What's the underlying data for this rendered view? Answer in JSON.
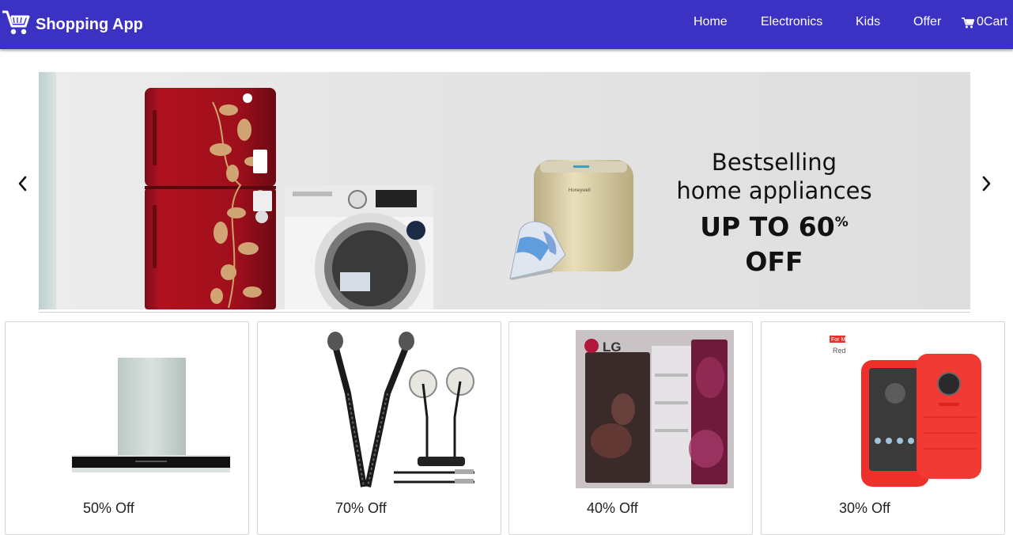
{
  "navbar": {
    "brand": "Shopping App",
    "brand_icon": "shopping-cart-icon",
    "links": [
      "Home",
      "Electronics",
      "Kids",
      "Offer"
    ],
    "cart_count": "0",
    "cart_label": "Cart",
    "background": "#3b31c3"
  },
  "carousel": {
    "banner_line1": "Bestselling",
    "banner_line2": "home appliances",
    "banner_line3_prefix": "UP TO 60",
    "banner_line3_percent": "%",
    "banner_line3_suffix": " OFF",
    "prev_icon": "chevron-left-icon",
    "next_icon": "chevron-right-icon",
    "brand_marks": [
      "Honeywell",
      "LG"
    ]
  },
  "products": [
    {
      "name": "chimney",
      "discount": "50% Off"
    },
    {
      "name": "earphones",
      "discount": "70% Off"
    },
    {
      "name": "refrigerator",
      "discount": "40% Off",
      "brand": "LG"
    },
    {
      "name": "phone-case",
      "discount": "30% Off",
      "caption_line1": "For  MOTO G5 Plus",
      "caption_line2": "Red"
    }
  ]
}
